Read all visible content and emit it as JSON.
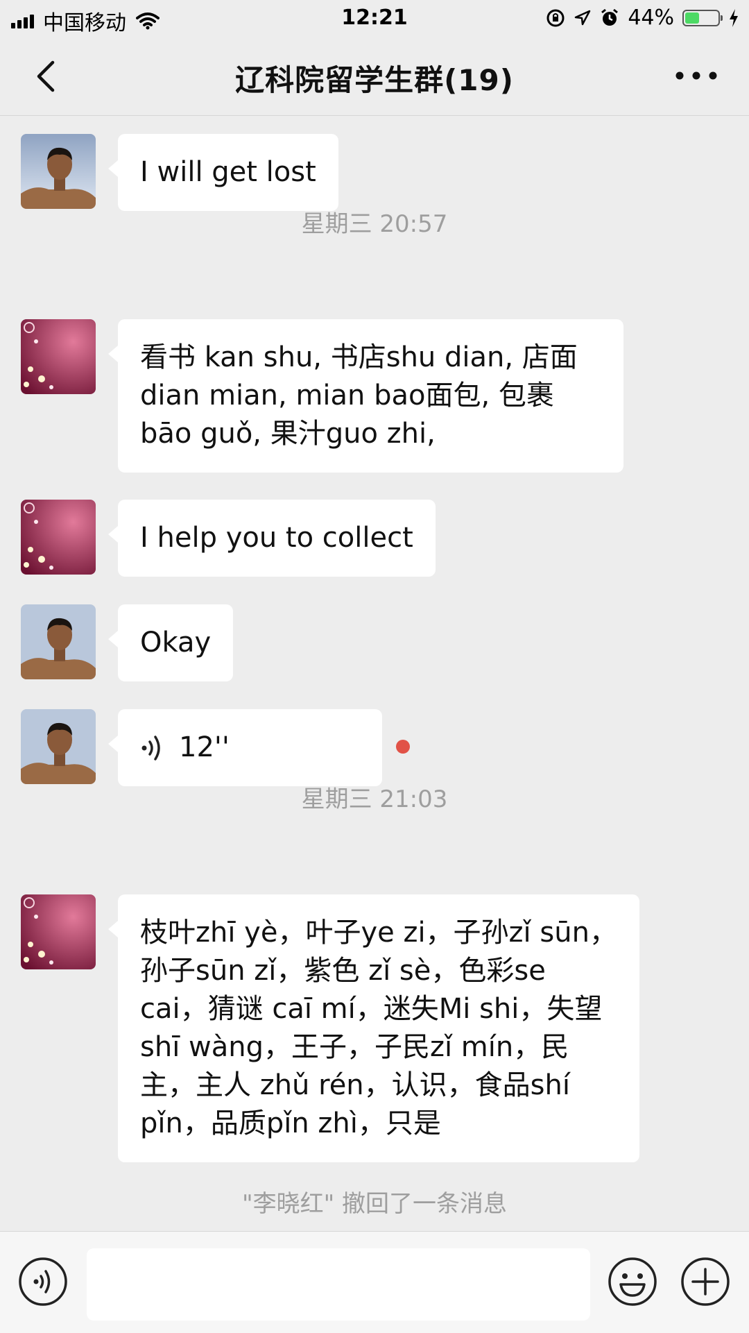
{
  "status_bar": {
    "carrier": "中国移动",
    "time": "12:21",
    "battery_percent": "44%",
    "battery_level": 0.44
  },
  "header": {
    "title": "辽科院留学生群(19)"
  },
  "messages": [
    {
      "type": "text",
      "sender": "male",
      "text": "I will get lost"
    },
    {
      "type": "timestamp",
      "text": "星期三 20:57"
    },
    {
      "type": "text",
      "sender": "female",
      "text": "看书 kan shu, 书店shu dian, 店面dian mian, mian bao面包, 包裹 bāo guǒ, 果汁guo zhi,"
    },
    {
      "type": "text",
      "sender": "female",
      "text": "I help you to collect"
    },
    {
      "type": "text",
      "sender": "male",
      "text": "Okay"
    },
    {
      "type": "voice",
      "sender": "male",
      "duration": "12''",
      "unread": true
    },
    {
      "type": "timestamp",
      "text": "星期三 21:03"
    },
    {
      "type": "text",
      "sender": "female",
      "text": "枝叶zhī yè，叶子ye zi，子孙zǐ sūn，孙子sūn zǐ，紫色 zǐ sè，色彩se cai，猜谜 caī mí，迷失Mi shi，失望shī wàng，王子，子民zǐ mín，民主，主人 zhǔ rén，认识，食品shí pǐn，品质pǐn zhì，只是"
    },
    {
      "type": "system",
      "text": "\"李晓红\" 撤回了一条消息"
    }
  ],
  "colors": {
    "background": "#ededed",
    "bubble": "#ffffff",
    "unread_dot": "#e15247",
    "battery_fill": "#4cd964"
  },
  "icons": {
    "back": "chevron-left-icon",
    "more": "more-dots-icon",
    "voice_toggle": "voice-icon",
    "emoji": "emoji-icon",
    "plus": "plus-icon"
  }
}
